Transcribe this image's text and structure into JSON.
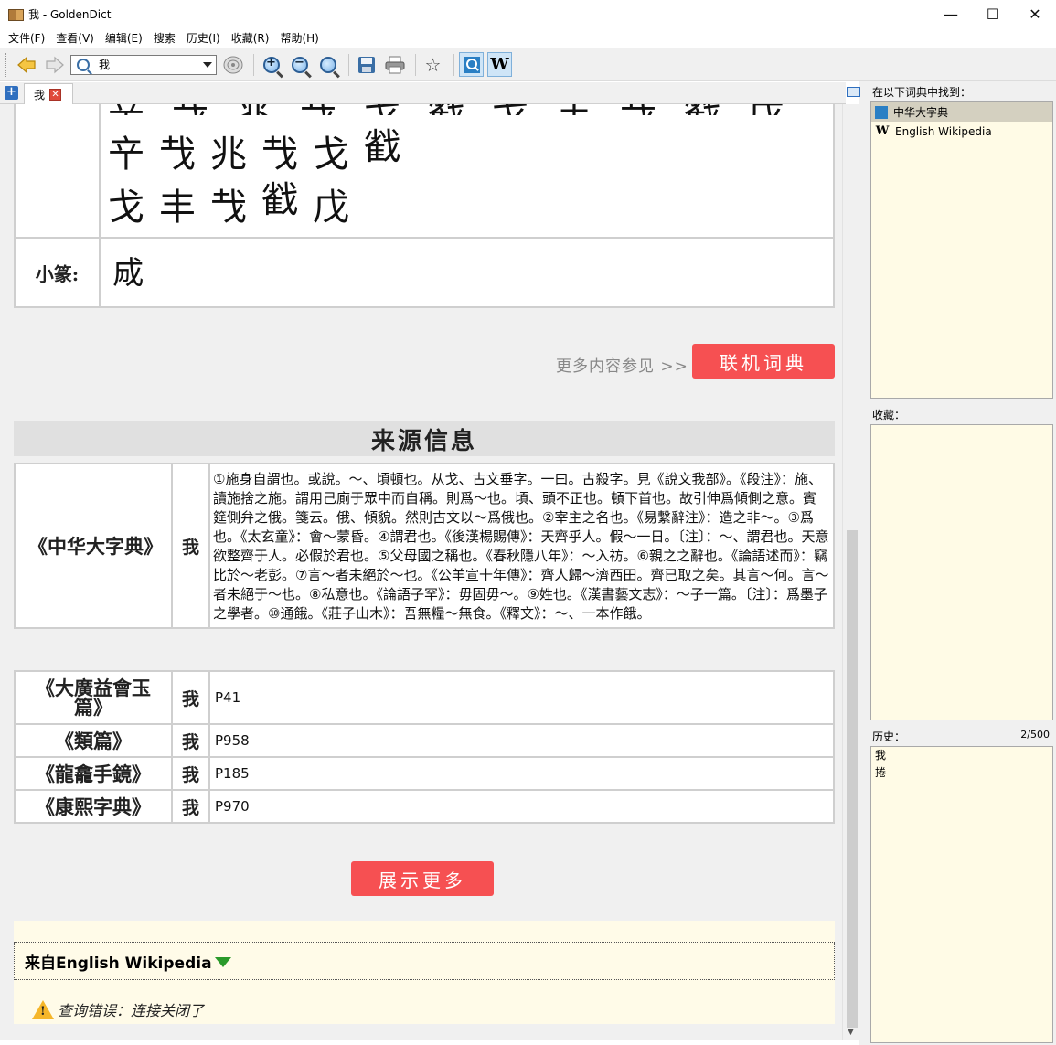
{
  "window": {
    "title": "我 - GoldenDict",
    "min_label": "—",
    "max_label": "☐",
    "close_label": "✕"
  },
  "menu": [
    "文件(F)",
    "查看(V)",
    "编辑(E)",
    "搜索",
    "历史(I)",
    "收藏(R)",
    "帮助(H)"
  ],
  "toolbar": {
    "search_value": "我",
    "zoom_in": "+",
    "zoom_out": "−",
    "zoom_reset": "",
    "star": "☆",
    "wiki": "W"
  },
  "tabs": [
    {
      "label": "我",
      "close": "✕"
    }
  ],
  "article": {
    "xiaozhuan_label": "小篆:",
    "xiaozhuan_glyph": "𢦓",
    "more_text": "更多内容参见 >>",
    "online_button": "联机词典",
    "source_title": "来源信息",
    "zhonghua": {
      "book": "《中华大字典》",
      "char": "我",
      "definition": "①施身自謂也。或說。～、頃頓也。从戈、古文垂字。一曰。古殺字。見《說文我部》。《段注》：施、讀施捨之施。謂用己廁于眾中而自稱。則爲～也。頃、頭不正也。頓下首也。故引伸爲傾側之意。賓筵側弁之俄。箋云。俄、傾貌。然則古文以～爲俄也。②宰主之名也。《易繫辭注》：造之非～。③爲也。《太玄童》：會～蒙昏。④謂君也。《後漢楊賜傳》：天齊乎人。假～一日。〔注〕：～、謂君也。天意欲整齊于人。必假於君也。⑤父母國之稱也。《春秋隱八年》：～入祊。⑥親之之辭也。《論語述而》：竊比於～老彭。⑦言～者未絕於～也。《公羊宣十年傳》：齊人歸～濟西田。齊已取之矣。其言～何。言～者未絕于～也。⑧私意也。《論語子罕》：毋固毋～。⑨姓也。《漢書藝文志》：～子一篇。〔注〕：爲墨子之學者。⑩通餓。《莊子山木》：吾無糧～無食。《釋文》：～、一本作餓。"
    },
    "refs": [
      {
        "book": "《大廣益會玉篇》",
        "char": "我",
        "page": "P41"
      },
      {
        "book": "《類篇》",
        "char": "我",
        "page": "P958"
      },
      {
        "book": "《龍龕手鏡》",
        "char": "我",
        "page": "P185"
      },
      {
        "book": "《康熙字典》",
        "char": "我",
        "page": "P970"
      }
    ],
    "show_more_button": "展示更多",
    "wiki_header": "来自English Wikipedia",
    "wiki_error": "查询错误：连接关闭了",
    "oracle_glyphs_row1": [
      "䇂",
      "𢦏",
      "兆",
      "𢦏",
      "戈",
      "𢧵"
    ],
    "oracle_glyphs_row2": [
      "戈",
      "丰",
      "𢦏",
      "𢧵",
      "戊"
    ]
  },
  "dock": {
    "found_title": "在以下词典中找到：",
    "found_items": [
      "中华大字典",
      "English Wikipedia"
    ],
    "favorites_title": "收藏：",
    "history_title": "历史：",
    "history_count": "2/500",
    "history_items": [
      "我",
      "捲"
    ]
  }
}
